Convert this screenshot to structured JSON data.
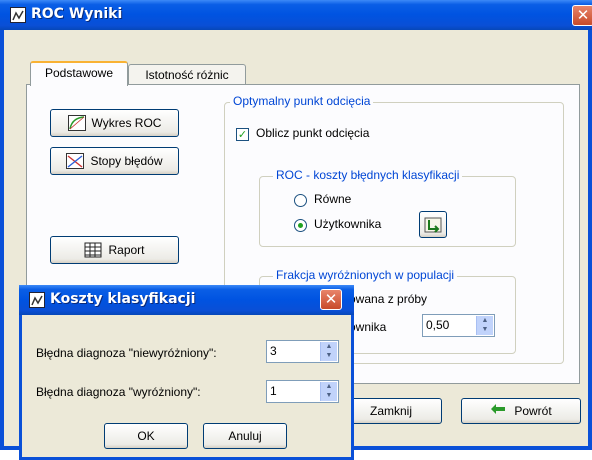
{
  "window": {
    "title": "ROC Wyniki",
    "close_glyph": "✕"
  },
  "tabs": [
    {
      "label": "Podstawowe",
      "active": true
    },
    {
      "label": "Istotność różnic",
      "active": false
    }
  ],
  "left_buttons": {
    "roc_chart": {
      "label": "Wykres ROC",
      "icon": "roc-curve-icon"
    },
    "error_rates": {
      "label": "Stopy błędów",
      "icon": "error-rates-icon"
    },
    "report": {
      "label": "Raport",
      "icon": "table-icon"
    }
  },
  "optimal_cutoff": {
    "title": "Optymalny punkt odcięcia",
    "compute_label": "Oblicz punkt odcięcia",
    "compute_checked": true,
    "costs_group": {
      "title": "ROC - koszty błędnych klasyfikacji",
      "equal_label": "Równe",
      "user_label": "Użytkownika",
      "selected": "user",
      "costs_button_icon": "edit-costs-icon"
    },
    "fraction_group": {
      "title": "Frakcja wyróżnionych w populacji",
      "estimated_label_partial": "owana z próby",
      "user_label_partial": "ownika",
      "user_value": "0,50"
    }
  },
  "bottom_buttons": {
    "close": "Zamknij",
    "back": "Powrót",
    "back_icon": "back-arrow-icon"
  },
  "dialog": {
    "title": "Koszty klasyfikacji",
    "close_glyph": "✕",
    "rows": [
      {
        "label": "Błędna diagnoza \"niewyróżniony\":",
        "value": "3"
      },
      {
        "label": "Błędna diagnoza \"wyróżniony\":",
        "value": "1"
      }
    ],
    "ok": "OK",
    "cancel": "Anuluj"
  },
  "colors": {
    "xp_blue": "#0053e1",
    "group_title": "#0046d5",
    "check_green": "#21a121",
    "window_bg": "#ece9d8"
  }
}
